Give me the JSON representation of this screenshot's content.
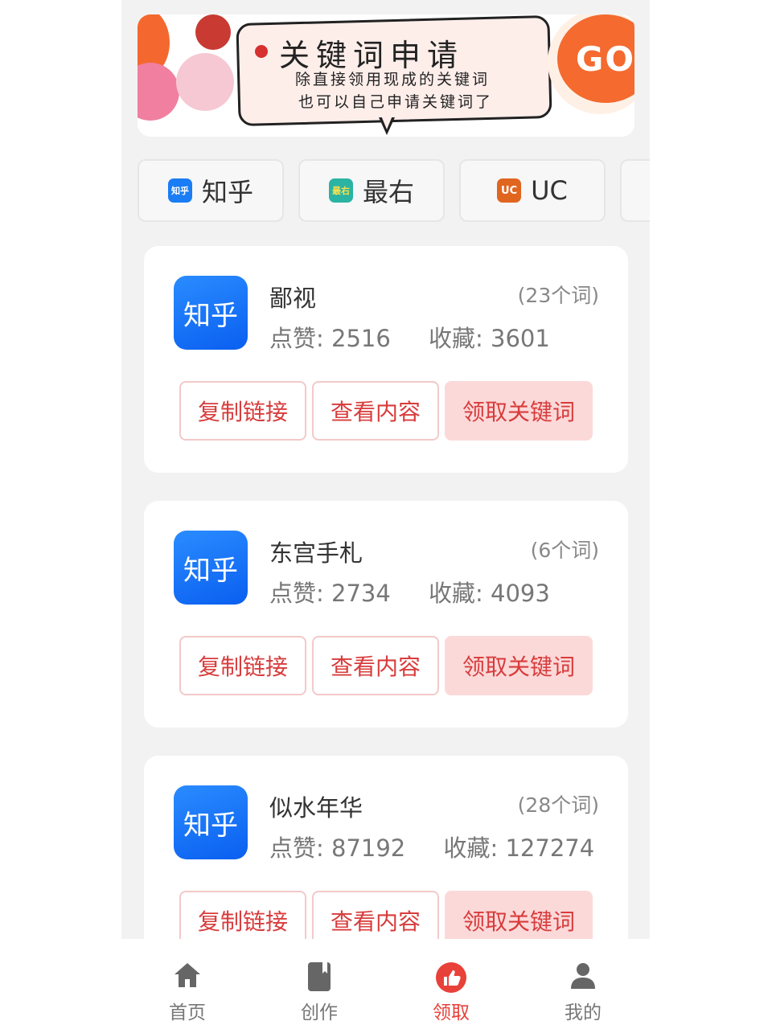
{
  "banner": {
    "title": "关键词申请",
    "line1": "除直接领用现成的关键词",
    "line2": "也可以自己申请关键词了",
    "go_label": "GO"
  },
  "tabs": [
    {
      "icon": "zhihu-icon",
      "icon_text": "知乎",
      "label": "知乎",
      "color": "#1a7df5"
    },
    {
      "icon": "zuiyou-icon",
      "icon_text": "最右",
      "label": "最右",
      "color": "#2bb3a3"
    },
    {
      "icon": "uc-icon",
      "icon_text": "UC",
      "label": "UC",
      "color": "#e0651f"
    }
  ],
  "cards": [
    {
      "logo_text": "知乎",
      "title": "鄙视",
      "count": "(23个词)",
      "likes_label": "点赞:",
      "likes": "2516",
      "favs_label": "收藏:",
      "favs": "3601"
    },
    {
      "logo_text": "知乎",
      "title": "东宫手札",
      "count": "(6个词)",
      "likes_label": "点赞:",
      "likes": "2734",
      "favs_label": "收藏:",
      "favs": "4093"
    },
    {
      "logo_text": "知乎",
      "title": "似水年华",
      "count": "(28个词)",
      "likes_label": "点赞:",
      "likes": "87192",
      "favs_label": "收藏:",
      "favs": "127274"
    }
  ],
  "buttons": {
    "copy_link": "复制链接",
    "view_content": "查看内容",
    "get_keywords": "领取关键词"
  },
  "nav": [
    {
      "label": "首页",
      "icon": "home-icon",
      "active": false
    },
    {
      "label": "创作",
      "icon": "book-icon",
      "active": false
    },
    {
      "label": "领取",
      "icon": "thumb-icon",
      "active": true
    },
    {
      "label": "我的",
      "icon": "person-icon",
      "active": false
    }
  ],
  "colors": {
    "accent": "#e8413a",
    "button_text": "#d83c3c",
    "button_fill": "#fcd9d9",
    "zhihu_blue": "#1a7df5"
  }
}
